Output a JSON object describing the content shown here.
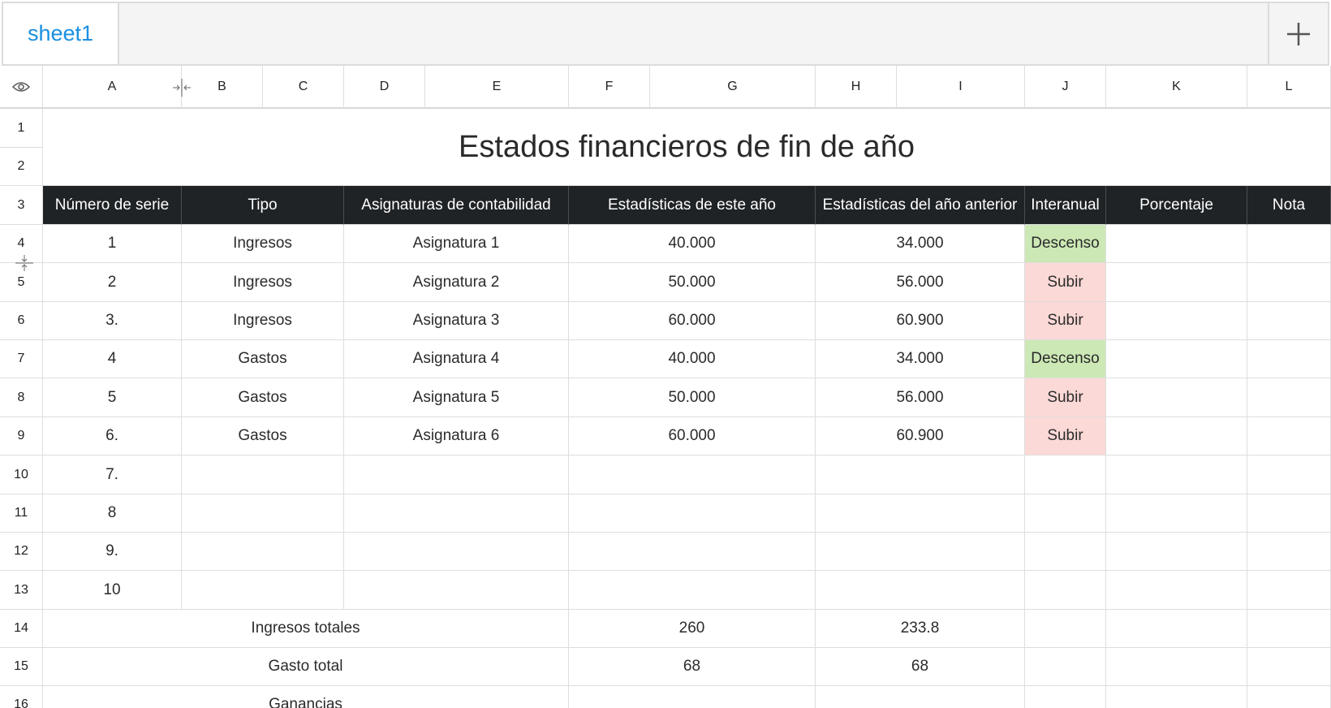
{
  "tabs": {
    "active": "sheet1",
    "add_label": "+"
  },
  "colors": {
    "header_bg": "#1f2326",
    "tab_accent": "#1a8fe0",
    "down": "#cce8b5",
    "up": "#fbd9d6"
  },
  "columns": [
    "A",
    "B",
    "C",
    "D",
    "E",
    "F",
    "G",
    "H",
    "I",
    "J",
    "K",
    "L"
  ],
  "rows": [
    "1",
    "2",
    "3",
    "4",
    "5",
    "6",
    "7",
    "8",
    "9",
    "10",
    "11",
    "12",
    "13",
    "14",
    "15",
    "16"
  ],
  "sheet": {
    "title": "Estados financieros de fin de año",
    "headers": {
      "serial": "Número de serie",
      "type": "Tipo",
      "subjects": "Asignaturas de contabilidad",
      "this_year": "Estadísticas de este año",
      "last_year": "Estadísticas del año anterior",
      "yoy": "Interanual",
      "percent": "Porcentaje",
      "note": "Nota"
    },
    "data_rows": [
      {
        "serial": "1",
        "type": "Ingresos",
        "subject": "Asignatura 1",
        "this_year": "40.000",
        "last_year": "34.000",
        "yoy": "Descenso"
      },
      {
        "serial": "2",
        "type": "Ingresos",
        "subject": "Asignatura 2",
        "this_year": "50.000",
        "last_year": "56.000",
        "yoy": "Subir"
      },
      {
        "serial": "3.",
        "type": "Ingresos",
        "subject": "Asignatura 3",
        "this_year": "60.000",
        "last_year": "60.900",
        "yoy": "Subir"
      },
      {
        "serial": "4",
        "type": "Gastos",
        "subject": "Asignatura 4",
        "this_year": "40.000",
        "last_year": "34.000",
        "yoy": "Descenso"
      },
      {
        "serial": "5",
        "type": "Gastos",
        "subject": "Asignatura 5",
        "this_year": "50.000",
        "last_year": "56.000",
        "yoy": "Subir"
      },
      {
        "serial": "6.",
        "type": "Gastos",
        "subject": "Asignatura 6",
        "this_year": "60.000",
        "last_year": "60.900",
        "yoy": "Subir"
      },
      {
        "serial": "7.",
        "type": "",
        "subject": "",
        "this_year": "",
        "last_year": "",
        "yoy": ""
      },
      {
        "serial": "8",
        "type": "",
        "subject": "",
        "this_year": "",
        "last_year": "",
        "yoy": ""
      },
      {
        "serial": "9.",
        "type": "",
        "subject": "",
        "this_year": "",
        "last_year": "",
        "yoy": ""
      },
      {
        "serial": "10",
        "type": "",
        "subject": "",
        "this_year": "",
        "last_year": "",
        "yoy": ""
      }
    ],
    "totals": [
      {
        "label": "Ingresos totales",
        "this_year": "260",
        "last_year": "233.8"
      },
      {
        "label": "Gasto total",
        "this_year": "68",
        "last_year": "68"
      },
      {
        "label": "Ganancias",
        "this_year": "",
        "last_year": ""
      }
    ]
  }
}
